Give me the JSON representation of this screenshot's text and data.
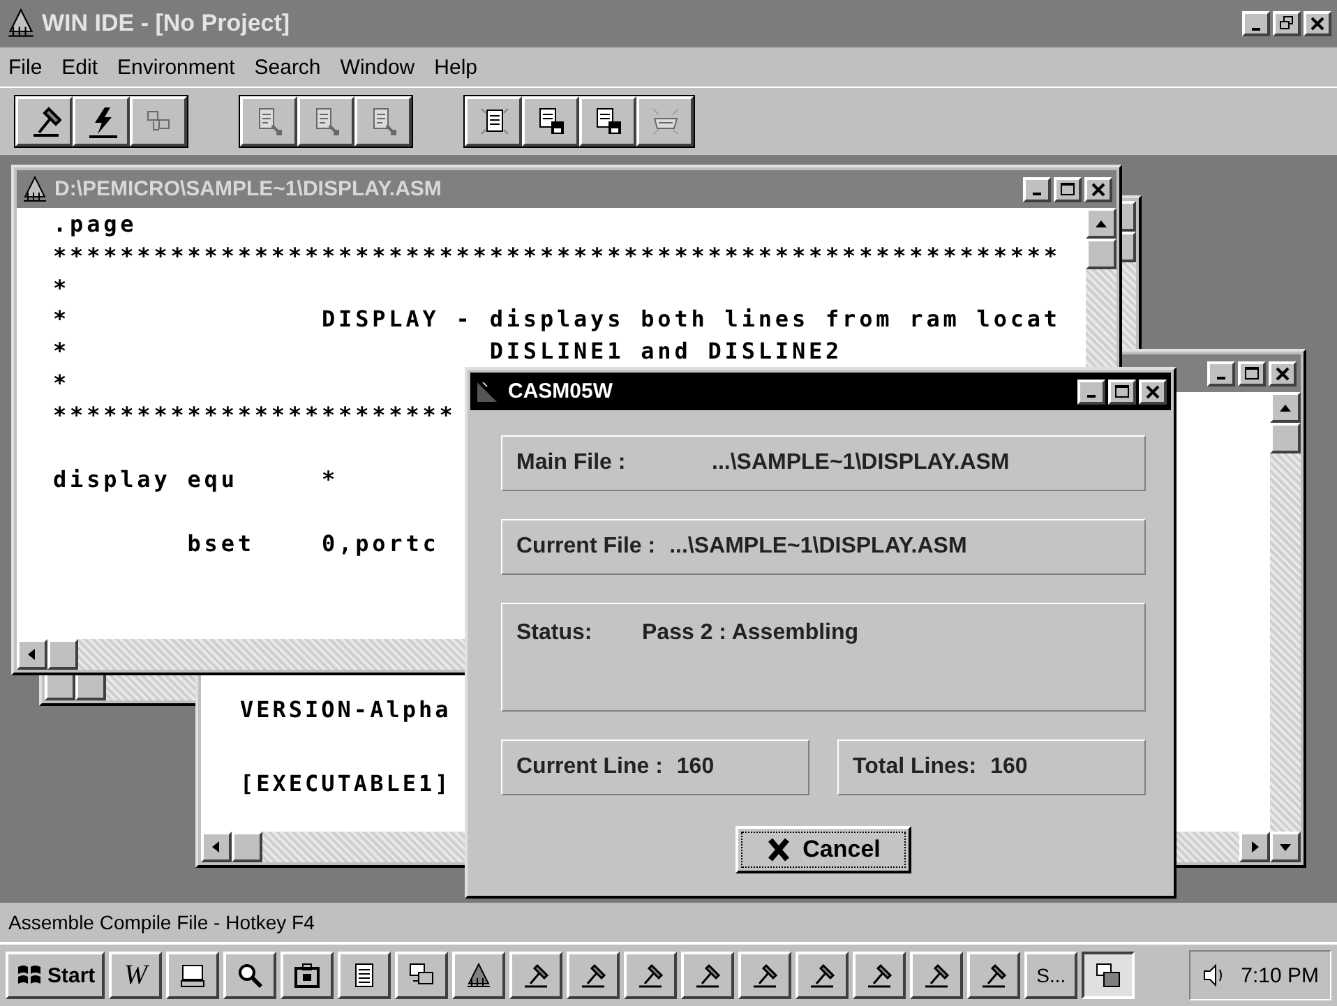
{
  "window": {
    "title": "WIN IDE - [No Project]"
  },
  "menu": [
    "File",
    "Edit",
    "Environment",
    "Search",
    "Window",
    "Help"
  ],
  "toolbar": [
    [
      {
        "kind": "hammer",
        "disabled": false
      },
      {
        "kind": "bolt",
        "disabled": false
      },
      {
        "kind": "blocks",
        "disabled": true
      }
    ],
    [
      {
        "kind": "doc-arrow",
        "disabled": true
      },
      {
        "kind": "doc-arrow",
        "disabled": true
      },
      {
        "kind": "doc-arrow",
        "disabled": true
      }
    ],
    [
      {
        "kind": "doc",
        "disabled": false
      },
      {
        "kind": "doc-disk",
        "disabled": false
      },
      {
        "kind": "doc-disk",
        "disabled": false
      },
      {
        "kind": "tray",
        "disabled": true
      }
    ]
  ],
  "source_window": {
    "title": "D:\\PEMICRO\\SAMPLE~1\\DISPLAY.ASM",
    "lines": [
      {
        "kind": "code",
        "text": ".page"
      },
      {
        "kind": "code",
        "text": "************************************************************"
      },
      {
        "kind": "code",
        "text": "*"
      },
      {
        "kind": "code",
        "text": "*               DISPLAY - displays both lines from ram locat"
      },
      {
        "kind": "code",
        "text": "*                         DISLINE1 and DISLINE2"
      },
      {
        "kind": "code",
        "text": "*"
      },
      {
        "kind": "code",
        "text": "************************"
      },
      {
        "kind": "blank"
      },
      {
        "kind": "code",
        "text": "display equ     *"
      },
      {
        "kind": "blank"
      },
      {
        "kind": "code",
        "text": "        bset    0,portc"
      }
    ]
  },
  "project_window": {
    "lines": [
      "VERSION-Alpha",
      "[EXECUTABLE1]"
    ]
  },
  "dialog": {
    "title": "CASM05W",
    "main_file_label": "Main File :",
    "main_file": "...\\SAMPLE~1\\DISPLAY.ASM",
    "current_file_label": "Current File :",
    "current_file": "...\\SAMPLE~1\\DISPLAY.ASM",
    "status_label": "Status:",
    "status": "Pass 2 : Assembling",
    "current_line_label": "Current Line :",
    "current_line": "160",
    "total_lines_label": "Total Lines:",
    "total_lines": "160",
    "cancel": "Cancel"
  },
  "status_bar": {
    "text": "Assemble Compile File - Hotkey F4"
  },
  "taskbar": {
    "start": "Start",
    "buttons": [
      {
        "kind": "text",
        "label": "W",
        "selected": false
      },
      {
        "kind": "computer",
        "selected": false
      },
      {
        "kind": "magnifier",
        "selected": false
      },
      {
        "kind": "briefcase",
        "selected": false
      },
      {
        "kind": "notepad",
        "selected": false
      },
      {
        "kind": "network",
        "selected": false
      },
      {
        "kind": "house",
        "selected": false
      },
      {
        "kind": "hammer",
        "selected": false
      },
      {
        "kind": "hammer",
        "selected": false
      },
      {
        "kind": "hammer",
        "selected": false
      },
      {
        "kind": "hammer",
        "selected": false
      },
      {
        "kind": "hammer",
        "selected": false
      },
      {
        "kind": "hammer",
        "selected": false
      },
      {
        "kind": "hammer",
        "selected": false
      },
      {
        "kind": "hammer",
        "selected": false
      },
      {
        "kind": "hammer",
        "selected": false
      },
      {
        "kind": "label",
        "label": "S...",
        "selected": false
      },
      {
        "kind": "app",
        "selected": true
      }
    ],
    "clock": "7:10 PM"
  }
}
